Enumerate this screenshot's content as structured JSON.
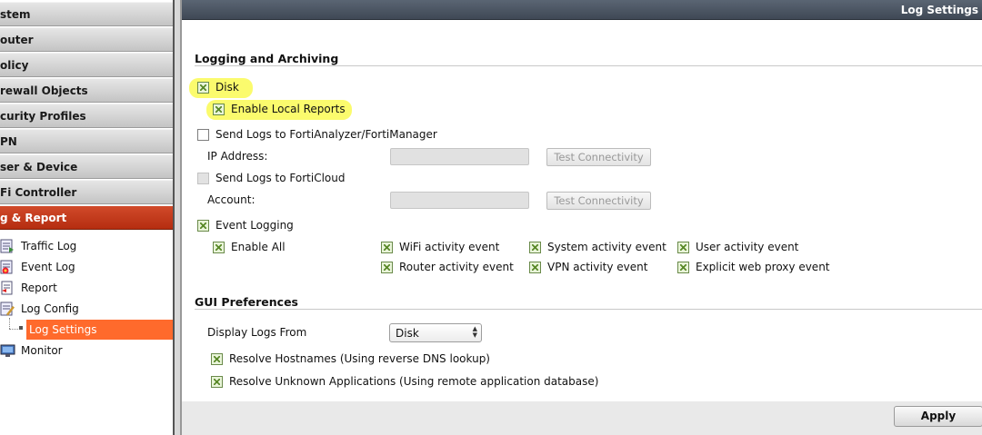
{
  "sidebar": {
    "menus": [
      {
        "label": "stem"
      },
      {
        "label": "outer"
      },
      {
        "label": "olicy"
      },
      {
        "label": "rewall Objects"
      },
      {
        "label": "curity Profiles"
      },
      {
        "label": "PN"
      },
      {
        "label": "ser & Device"
      },
      {
        "label": "Fi Controller"
      },
      {
        "label": "g & Report",
        "active": true
      }
    ],
    "items": [
      {
        "label": "Traffic Log",
        "icon": "traffic-log-icon"
      },
      {
        "label": "Event Log",
        "icon": "event-log-icon"
      },
      {
        "label": "Report",
        "icon": "report-icon"
      },
      {
        "label": "Log Config",
        "icon": "log-config-icon"
      },
      {
        "label": "Log Settings",
        "selected": true
      },
      {
        "label": "Monitor",
        "icon": "monitor-icon"
      }
    ]
  },
  "header": {
    "title": "Log Settings"
  },
  "logging": {
    "title": "Logging and Archiving",
    "disk_label": "Disk",
    "disk_checked": true,
    "local_reports_label": "Enable Local Reports",
    "local_reports_checked": true,
    "fortianalyzer_label": "Send Logs to FortiAnalyzer/FortiManager",
    "fortianalyzer_checked": false,
    "ip_label": "IP Address:",
    "ip_value": "",
    "test_label": "Test Connectivity",
    "forticloud_label": "Send Logs to FortiCloud",
    "forticloud_checked": false,
    "account_label": "Account:",
    "account_value": "",
    "event_logging_label": "Event Logging",
    "event_logging_checked": true,
    "enable_all_label": "Enable All",
    "events": [
      {
        "label": "WiFi activity event",
        "checked": true
      },
      {
        "label": "System activity event",
        "checked": true
      },
      {
        "label": "User activity event",
        "checked": true
      },
      {
        "label": "Router activity event",
        "checked": true
      },
      {
        "label": "VPN activity event",
        "checked": true
      },
      {
        "label": "Explicit web proxy event",
        "checked": true
      }
    ]
  },
  "gui": {
    "title": "GUI Preferences",
    "display_from_label": "Display Logs From",
    "display_from_value": "Disk",
    "resolve_hostnames_label": "Resolve Hostnames (Using reverse DNS lookup)",
    "resolve_hostnames_checked": true,
    "resolve_apps_label": "Resolve Unknown Applications (Using remote application database)",
    "resolve_apps_checked": true
  },
  "apply_label": "Apply",
  "colors": {
    "accent": "#ff6a2c",
    "active_menu": "#c33b1c",
    "highlight": "#fafa3c"
  }
}
